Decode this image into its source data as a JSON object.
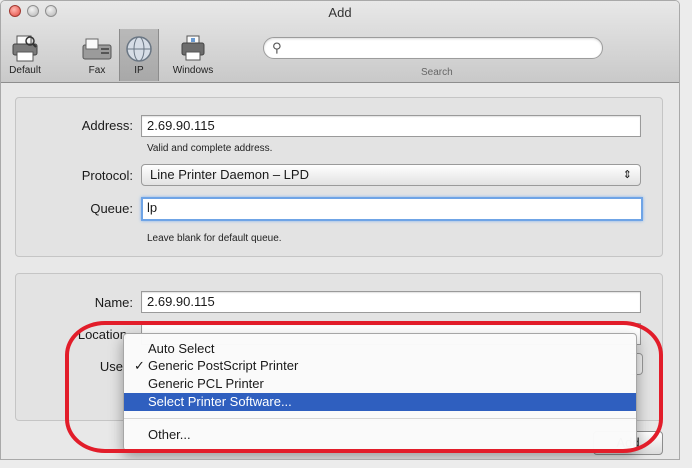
{
  "window": {
    "title": "Add"
  },
  "toolbar": {
    "items": [
      {
        "label": "Default",
        "icon": "printer-icon"
      },
      {
        "label": "Fax",
        "icon": "fax-icon"
      },
      {
        "label": "IP",
        "icon": "globe-icon"
      },
      {
        "label": "Windows",
        "icon": "windows-printer-icon"
      }
    ],
    "search_label": "Search",
    "search_placeholder": ""
  },
  "ip_panel": {
    "address_label": "Address:",
    "address_value": "2.69.90.115",
    "address_hint": "Valid and complete address.",
    "protocol_label": "Protocol:",
    "protocol_value": "Line Printer Daemon – LPD",
    "queue_label": "Queue:",
    "queue_value": "lp",
    "queue_hint": "Leave blank for default queue."
  },
  "info_panel": {
    "name_label": "Name:",
    "name_value": "2.69.90.115",
    "location_label": "Location",
    "use_label": "Use"
  },
  "menu": {
    "items": [
      {
        "label": "Auto Select",
        "checked": false,
        "highlighted": false
      },
      {
        "label": "Generic PostScript Printer",
        "checked": true,
        "highlighted": false
      },
      {
        "label": "Generic PCL Printer",
        "checked": false,
        "highlighted": false
      },
      {
        "label": "Select Printer Software...",
        "checked": false,
        "highlighted": true
      },
      {
        "label": "Other...",
        "checked": false,
        "highlighted": false
      }
    ],
    "check_glyph": "✓"
  },
  "buttons": {
    "add_label": "Add"
  },
  "colors": {
    "highlight": "#2f5fbf",
    "annotation": "#e21d2a",
    "focus": "#6fa4e6"
  }
}
